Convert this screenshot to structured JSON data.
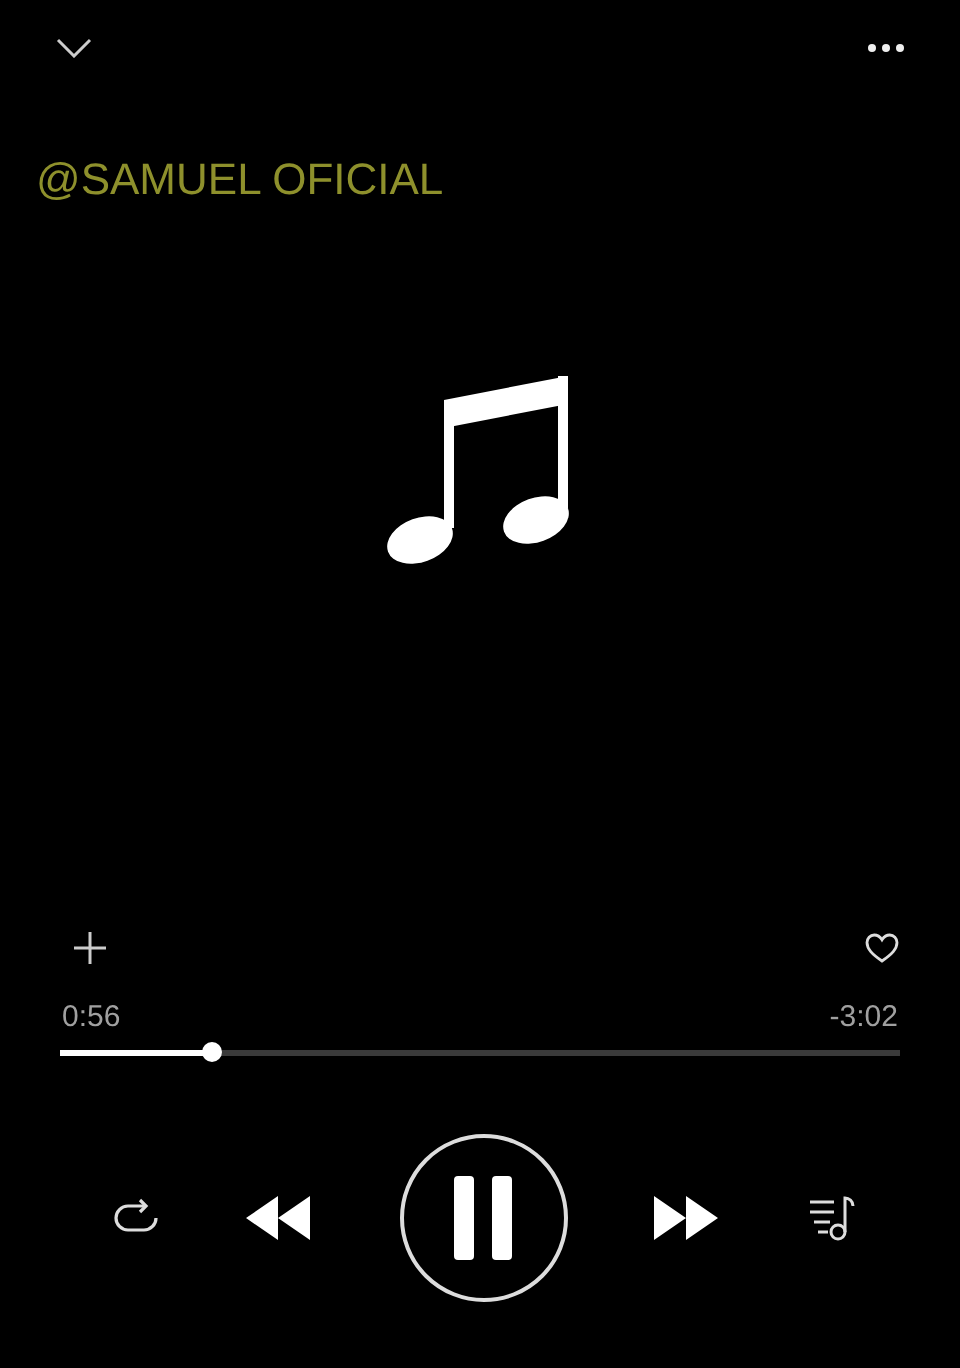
{
  "artist": "@SAMUEL OFICIAL",
  "progress": {
    "elapsed": "0:56",
    "remaining": "-3:02",
    "level": 0.18
  },
  "player": {
    "playing": true
  }
}
